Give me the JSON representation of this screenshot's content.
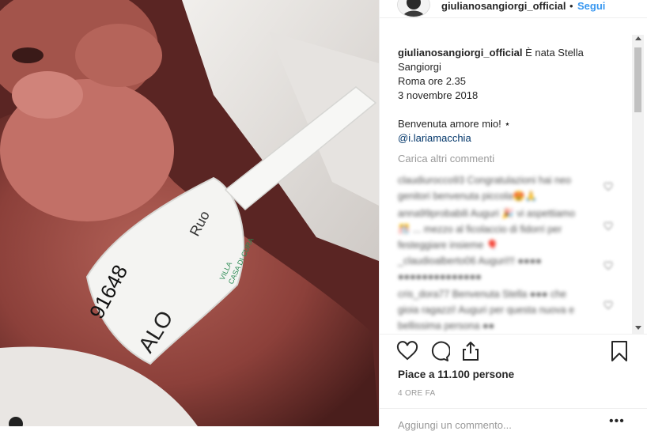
{
  "post": {
    "username": "giulianosangiorgi_official",
    "separator": "•",
    "follow_label": "Segui"
  },
  "caption": {
    "username": "giulianosangiorgi_official",
    "line1": "È nata Stella Sangiorgi",
    "line2": "Roma ore 2.35",
    "line3": "3 novembre 2018",
    "line4": "Benvenuta amore mio! ⋆",
    "mention": "@i.lariamacchia"
  },
  "load_more": "Carica altri commenti",
  "comments_blurred": [
    "claudiurocco93 Congratulazioni hai neo genitori benvenuta piccola😍🙏",
    "anna99probabili Auguri 🎉 vi aspettiamo 🎊 ... mezzo al ficolaccio di fidorri per festeggiare insieme 🎈",
    "_claudioalberto06 Auguri!!! ●●●● ●●●●●●●●●●●●●●",
    "cris_dora77 Benvenuta Stella ●●● che gioia ragazzi! Auguri per questa nuova e bellissima persona ●●"
  ],
  "likes": "Piace a 11.100 persone",
  "time": "4 ORE FA",
  "add_comment_placeholder": "Aggiungi un commento...",
  "more_label": "•••",
  "colors": {
    "link": "#3897f0",
    "mention": "#003569",
    "muted": "#999999"
  }
}
